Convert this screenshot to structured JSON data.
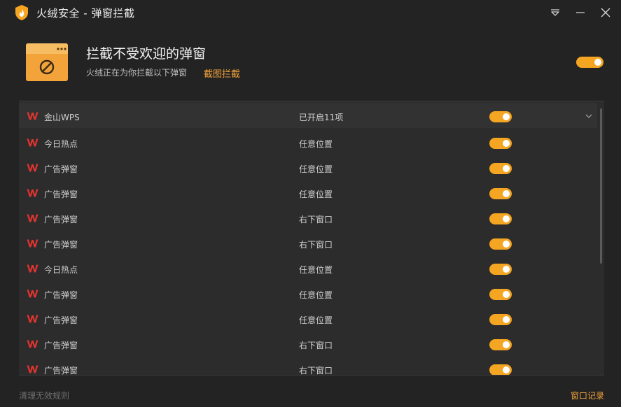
{
  "window": {
    "title": "火绒安全 - 弹窗拦截"
  },
  "header": {
    "title": "拦截不受欢迎的弹窗",
    "subtitle": "火绒正在为你拦截以下弹窗",
    "link": "截图拦截",
    "master_enabled": true
  },
  "list": {
    "rows": [
      {
        "name": "金山WPS",
        "position": "已开启11项",
        "enabled": true,
        "expandable": true
      },
      {
        "name": "今日热点",
        "position": "任意位置",
        "enabled": true
      },
      {
        "name": "广告弹窗",
        "position": "任意位置",
        "enabled": true
      },
      {
        "name": "广告弹窗",
        "position": "任意位置",
        "enabled": true
      },
      {
        "name": "广告弹窗",
        "position": "右下窗口",
        "enabled": true
      },
      {
        "name": "广告弹窗",
        "position": "右下窗口",
        "enabled": true
      },
      {
        "name": "今日热点",
        "position": "任意位置",
        "enabled": true
      },
      {
        "name": "广告弹窗",
        "position": "任意位置",
        "enabled": true
      },
      {
        "name": "广告弹窗",
        "position": "任意位置",
        "enabled": true
      },
      {
        "name": "广告弹窗",
        "position": "右下窗口",
        "enabled": true
      },
      {
        "name": "广告弹窗",
        "position": "右下窗口",
        "enabled": true
      }
    ]
  },
  "footer": {
    "left": "清理无效规则",
    "right": "窗口记录"
  },
  "colors": {
    "accent": "#f4a521",
    "link": "#f0a23a",
    "wps_red": "#e5342f",
    "background": "#232323"
  },
  "icons": [
    "huorong-logo-icon",
    "menu-icon",
    "minimize-icon",
    "close-icon",
    "popup-block-icon",
    "wps-icon",
    "chevron-down-icon"
  ]
}
